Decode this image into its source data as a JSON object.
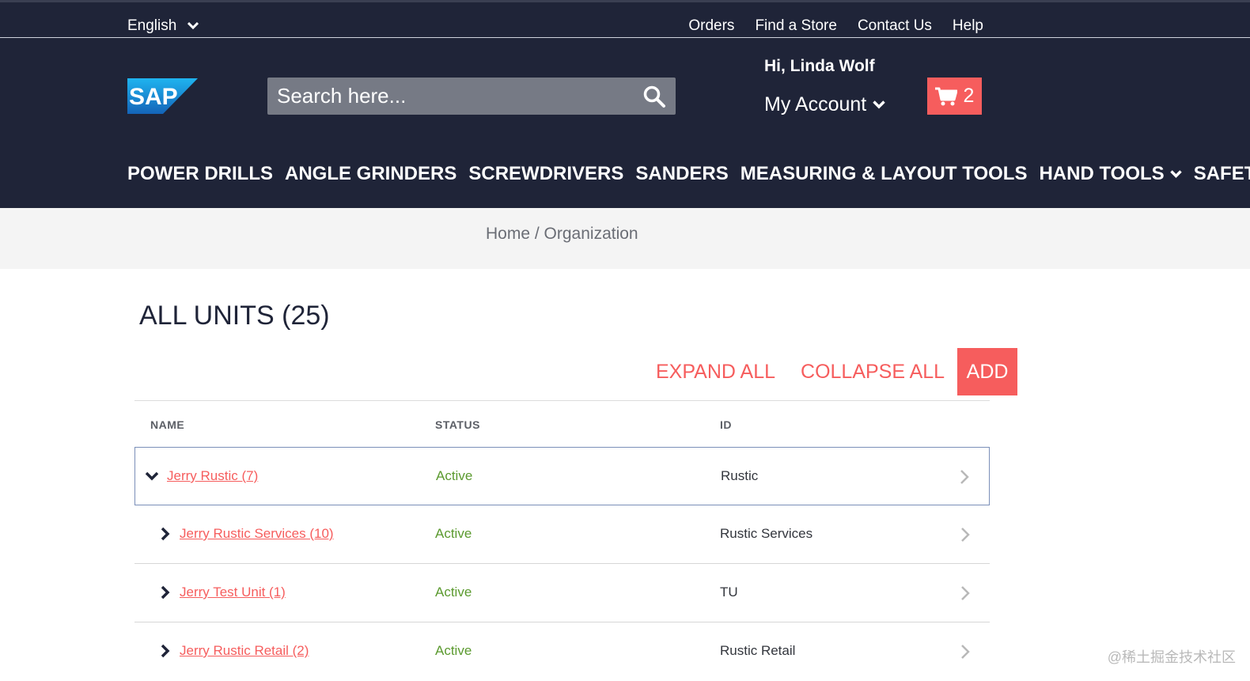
{
  "topbar": {
    "language": "English",
    "links": [
      "Orders",
      "Find a Store",
      "Contact Us",
      "Help"
    ]
  },
  "header": {
    "logo_text": "SAP",
    "search_placeholder": "Search here...",
    "greeting": "Hi, Linda Wolf",
    "account_label": "My Account",
    "cart_count": "2"
  },
  "nav": {
    "items": [
      {
        "label": "POWER DRILLS",
        "dropdown": false
      },
      {
        "label": "ANGLE GRINDERS",
        "dropdown": false
      },
      {
        "label": "SCREWDRIVERS",
        "dropdown": false
      },
      {
        "label": "SANDERS",
        "dropdown": false
      },
      {
        "label": "MEASURING & LAYOUT TOOLS",
        "dropdown": false
      },
      {
        "label": "HAND TOOLS",
        "dropdown": true
      },
      {
        "label": "SAFETY",
        "dropdown": true
      }
    ]
  },
  "breadcrumb": {
    "home": "Home",
    "separator": " / ",
    "current": "Organization"
  },
  "page": {
    "title": "ALL UNITS (25)",
    "expand_all": "EXPAND ALL",
    "collapse_all": "COLLAPSE ALL",
    "add": "ADD"
  },
  "table": {
    "columns": [
      "NAME",
      "STATUS",
      "ID"
    ],
    "rows": [
      {
        "name": "Jerry Rustic (7)",
        "status": "Active",
        "id": "Rustic",
        "expanded": true,
        "level": 0
      },
      {
        "name": "Jerry Rustic Services (10)",
        "status": "Active",
        "id": "Rustic Services",
        "expanded": false,
        "level": 1
      },
      {
        "name": "Jerry Test Unit (1)",
        "status": "Active",
        "id": "TU",
        "expanded": false,
        "level": 1
      },
      {
        "name": "Jerry Rustic Retail (2)",
        "status": "Active",
        "id": "Rustic Retail",
        "expanded": false,
        "level": 1
      }
    ]
  },
  "watermark": "@稀土掘金技术社区",
  "colors": {
    "header_bg": "#1f2438",
    "accent": "#f65d5d",
    "active_status": "#5b9a2f"
  }
}
